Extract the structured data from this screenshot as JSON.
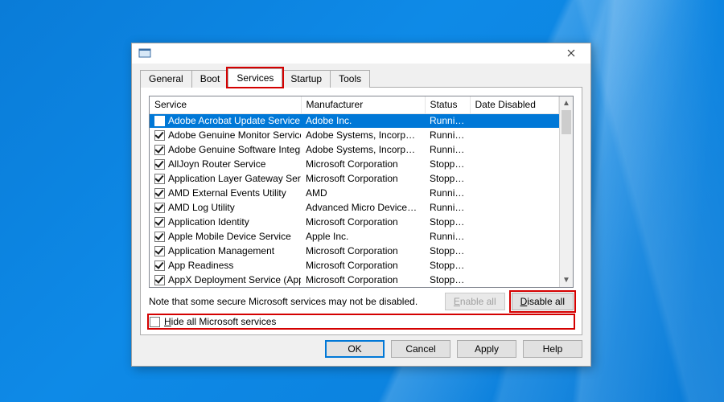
{
  "tabs": {
    "general": "General",
    "boot": "Boot",
    "services": "Services",
    "startup": "Startup",
    "tools": "Tools",
    "active": "services"
  },
  "columns": {
    "service": "Service",
    "manufacturer": "Manufacturer",
    "status": "Status",
    "date_disabled": "Date Disabled"
  },
  "services": [
    {
      "checked": true,
      "name": "Adobe Acrobat Update Service",
      "manufacturer": "Adobe Inc.",
      "status": "Running",
      "selected": true
    },
    {
      "checked": true,
      "name": "Adobe Genuine Monitor Service",
      "manufacturer": "Adobe Systems, Incorpora...",
      "status": "Running"
    },
    {
      "checked": true,
      "name": "Adobe Genuine Software Integri...",
      "manufacturer": "Adobe Systems, Incorpora...",
      "status": "Running"
    },
    {
      "checked": true,
      "name": "AllJoyn Router Service",
      "manufacturer": "Microsoft Corporation",
      "status": "Stopped"
    },
    {
      "checked": true,
      "name": "Application Layer Gateway Service",
      "manufacturer": "Microsoft Corporation",
      "status": "Stopped"
    },
    {
      "checked": true,
      "name": "AMD External Events Utility",
      "manufacturer": "AMD",
      "status": "Running"
    },
    {
      "checked": true,
      "name": "AMD Log Utility",
      "manufacturer": "Advanced Micro Devices, I...",
      "status": "Running"
    },
    {
      "checked": true,
      "name": "Application Identity",
      "manufacturer": "Microsoft Corporation",
      "status": "Stopped"
    },
    {
      "checked": true,
      "name": "Apple Mobile Device Service",
      "manufacturer": "Apple Inc.",
      "status": "Running"
    },
    {
      "checked": true,
      "name": "Application Management",
      "manufacturer": "Microsoft Corporation",
      "status": "Stopped"
    },
    {
      "checked": true,
      "name": "App Readiness",
      "manufacturer": "Microsoft Corporation",
      "status": "Stopped"
    },
    {
      "checked": true,
      "name": "AppX Deployment Service (AppX...",
      "manufacturer": "Microsoft Corporation",
      "status": "Stopped"
    }
  ],
  "note": "Note that some secure Microsoft services may not be disabled.",
  "buttons": {
    "enable_all": "Enable all",
    "disable_all": "Disable all",
    "ok": "OK",
    "cancel": "Cancel",
    "apply": "Apply",
    "help": "Help"
  },
  "hide_ms": {
    "label_pre": "H",
    "label_post": "ide all Microsoft services",
    "checked": false
  },
  "highlights": {
    "services_tab": true,
    "disable_all": true,
    "hide_ms": true
  }
}
